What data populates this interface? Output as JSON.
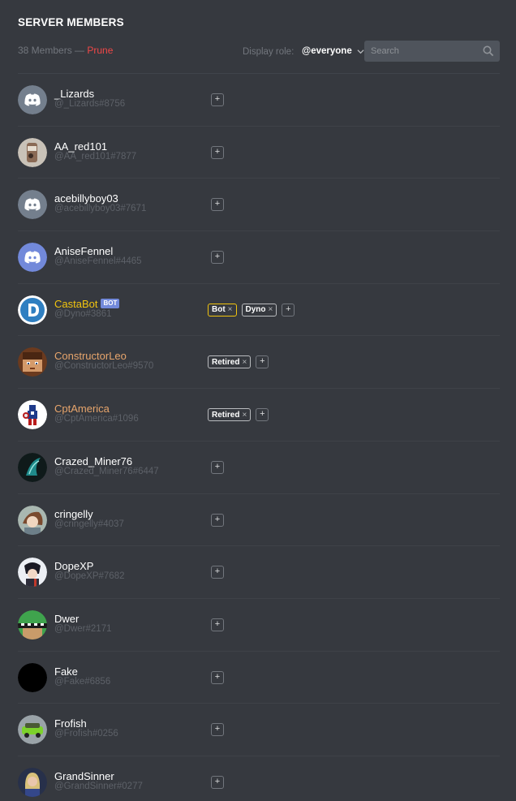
{
  "header": {
    "title": "SERVER MEMBERS",
    "member_count": "38 Members —",
    "prune_label": "Prune",
    "display_role_label": "Display role:",
    "display_role_value": "@everyone",
    "search_placeholder": "Search"
  },
  "colors": {
    "background": "#36393f",
    "blurple": "#7289da",
    "prune_red": "#f04747",
    "gold_name": "#f1c40f",
    "orange_name": "#e7a56c"
  },
  "members": [
    {
      "name": "_Lizards",
      "tag": "@_Lizards#8756",
      "avatar": "discord-grey",
      "roles": []
    },
    {
      "name": "AA_red101",
      "tag": "@AA_red101#7877",
      "avatar": "photo-can",
      "roles": []
    },
    {
      "name": "acebillyboy03",
      "tag": "@acebillyboy03#7671",
      "avatar": "discord-grey",
      "roles": []
    },
    {
      "name": "AniseFennel",
      "tag": "@AniseFennel#4465",
      "avatar": "discord-blurple",
      "roles": []
    },
    {
      "name": "CastaBot",
      "tag": "@Dyno#3861",
      "avatar": "dyno-logo",
      "name_color": "#f1c40f",
      "badge": "BOT",
      "roles": [
        {
          "label": "Bot",
          "border": "#f1c40f"
        },
        {
          "label": "Dyno",
          "border": "#b9bbbe"
        }
      ]
    },
    {
      "name": "ConstructorLeo",
      "tag": "@ConstructorLeo#9570",
      "avatar": "pixel-face",
      "name_color": "#e7a56c",
      "roles": [
        {
          "label": "Retired",
          "border": "#b9bbbe"
        }
      ]
    },
    {
      "name": "CptAmerica",
      "tag": "@CptAmerica#1096",
      "avatar": "captain-figure",
      "name_color": "#e7a56c",
      "roles": [
        {
          "label": "Retired",
          "border": "#b9bbbe"
        }
      ]
    },
    {
      "name": "Crazed_Miner76",
      "tag": "@Crazed_Miner76#6447",
      "avatar": "dark-art",
      "roles": []
    },
    {
      "name": "cringelly",
      "tag": "@cringelly#4037",
      "avatar": "anime-art",
      "roles": []
    },
    {
      "name": "DopeXP",
      "tag": "@DopeXP#7682",
      "avatar": "anime-dark",
      "roles": []
    },
    {
      "name": "Dwer",
      "tag": "@Dwer#2171",
      "avatar": "pixel-creeper",
      "roles": []
    },
    {
      "name": "Fake",
      "tag": "@Fake#6856",
      "avatar": "black-circle",
      "roles": []
    },
    {
      "name": "Frofish",
      "tag": "@Frofish#0256",
      "avatar": "green-car",
      "roles": []
    },
    {
      "name": "GrandSinner",
      "tag": "@GrandSinner#0277",
      "avatar": "portrait",
      "roles": []
    }
  ]
}
